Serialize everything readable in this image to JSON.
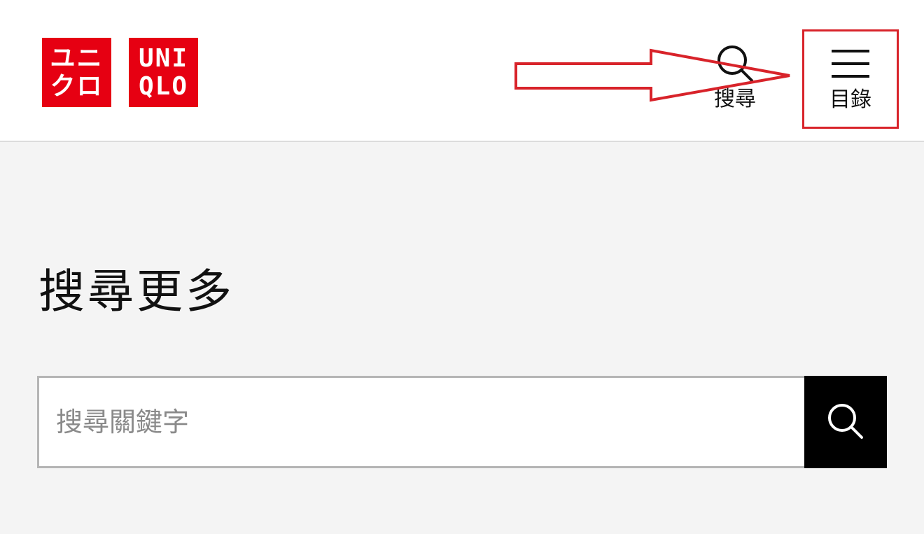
{
  "brand": {
    "logo_katakana_line1": "ユニ",
    "logo_katakana_line2": "クロ",
    "logo_latin_line1": "UNI",
    "logo_latin_line2": "QLO",
    "color": "#e60012"
  },
  "header": {
    "search_label": "搜尋",
    "search_icon": "search-icon",
    "menu_label": "目錄",
    "menu_icon": "hamburger-menu-icon"
  },
  "annotation": {
    "color": "#d8232a",
    "shapes": [
      "arrow",
      "highlight-box"
    ]
  },
  "main": {
    "title": "搜尋更多",
    "search": {
      "placeholder": "搜尋關鍵字",
      "value": "",
      "submit_icon": "search-icon"
    }
  }
}
